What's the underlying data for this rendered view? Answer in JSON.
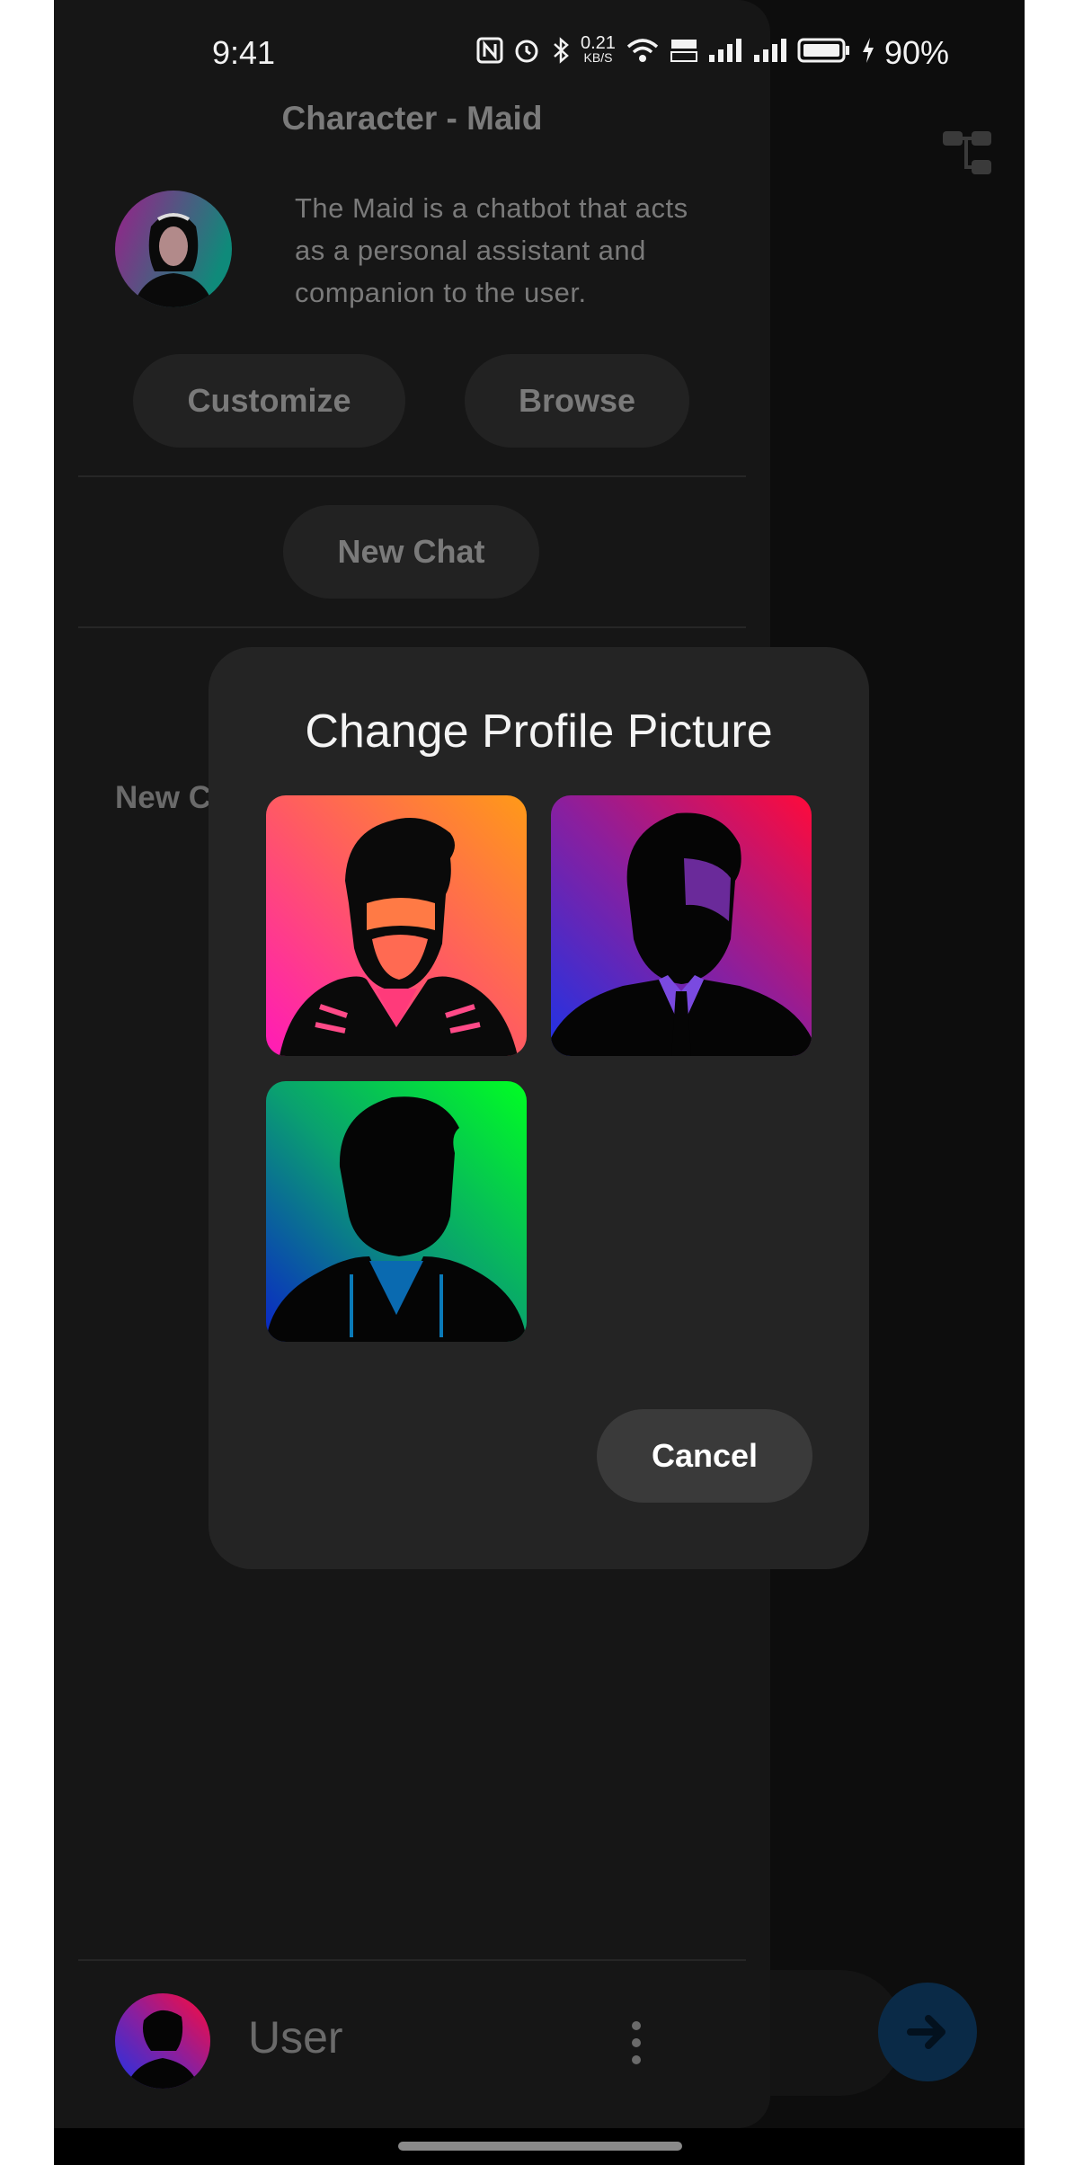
{
  "status_bar": {
    "time": "9:41",
    "network_speed": "0.21",
    "network_speed_unit": "KB/S",
    "battery": "90%",
    "icons": [
      "nfc-icon",
      "alarm-icon",
      "bluetooth-icon",
      "wifi-icon",
      "volte-icon",
      "signal-icon",
      "signal-icon",
      "battery-icon",
      "charging-icon"
    ]
  },
  "drawer": {
    "title": "Character - Maid",
    "character_description": "The Maid is a chatbot that acts as a personal assistant and companion to the user.",
    "customize_label": "Customize",
    "browse_label": "Browse",
    "new_chat_label": "New Chat",
    "session_item": "New C",
    "user_name": "User"
  },
  "dialog": {
    "title": "Change Profile Picture",
    "cancel_label": "Cancel",
    "pictures": [
      "avatar-bearded-man",
      "avatar-suit-man",
      "avatar-hoodie-man"
    ]
  },
  "colors": {
    "background": "#0d0d0d",
    "drawer": "#161616",
    "dialog": "#242424",
    "send_button": "#0a2a47"
  }
}
